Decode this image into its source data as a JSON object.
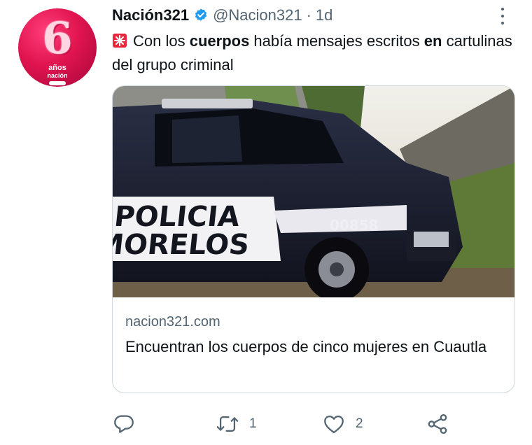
{
  "account": {
    "display_name": "Nación321",
    "handle": "@Nacion321",
    "separator": "·",
    "time": "1d",
    "avatar_number": "6",
    "avatar_caption_top": "años",
    "avatar_caption_bottom": "nación"
  },
  "tweet": {
    "segments": [
      {
        "text": "Con los ",
        "bold": false
      },
      {
        "text": "cuerpos",
        "bold": true
      },
      {
        "text": " había mensajes escritos ",
        "bold": false
      },
      {
        "text": "en",
        "bold": true
      },
      {
        "text": " cartulinas del grupo criminal",
        "bold": false
      }
    ]
  },
  "card": {
    "image_text_line1": "POLICIA",
    "image_text_line2": "MORELOS",
    "image_unit_number": "00858",
    "domain": "nacion321.com",
    "title": "Encuentran los cuerpos de cinco mujeres en Cuautla"
  },
  "actions": {
    "reply_count": "",
    "retweet_count": "1",
    "like_count": "2"
  },
  "colors": {
    "verified": "#1d9bf0",
    "muted_text": "#536471",
    "card_border": "#cfd9de",
    "avatar": "#e0144f"
  },
  "icons": [
    "verified-badge-icon",
    "more-icon",
    "siren-icon",
    "reply-icon",
    "retweet-icon",
    "like-icon",
    "share-icon"
  ]
}
